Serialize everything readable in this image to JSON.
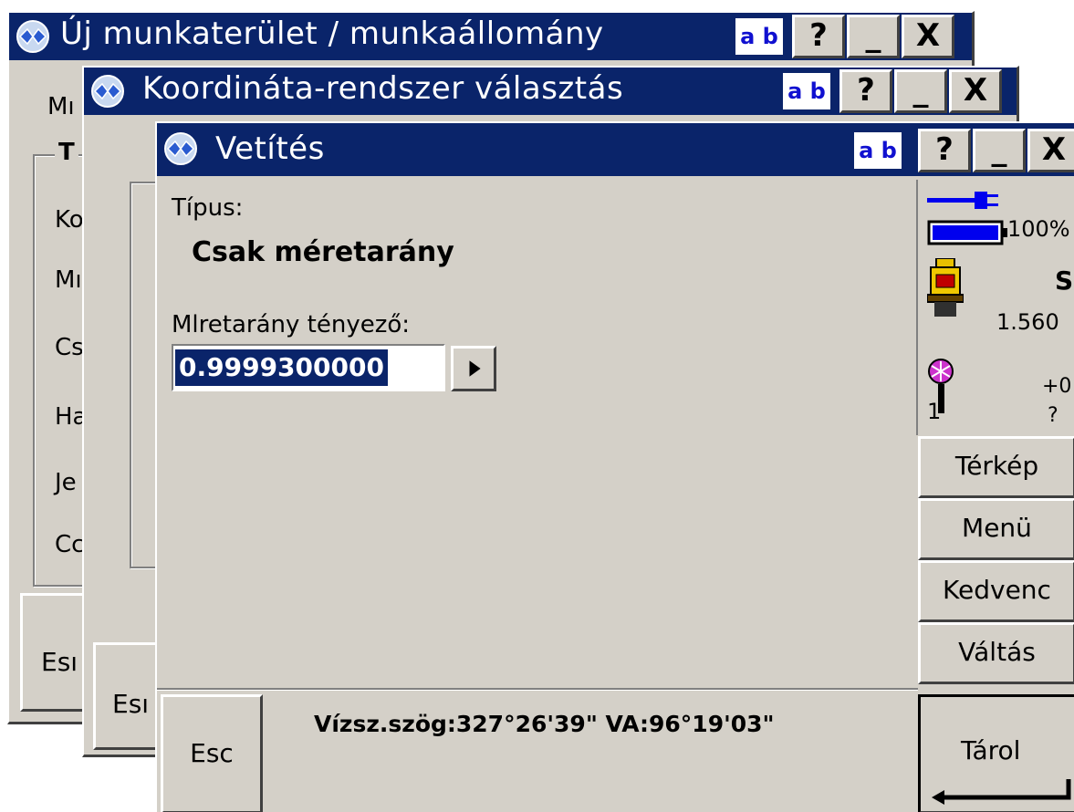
{
  "windows": {
    "back": {
      "title": "Új munkaterület / munkaállomány",
      "ab_label": "a b",
      "help_label": "?",
      "minimize_label": "_",
      "close_label": "X",
      "partial_labels": [
        "Mı",
        "Ko",
        "Mı",
        "Cs",
        "Ha",
        "Je",
        "Cc"
      ],
      "group_label": "T",
      "esc_label": "Esı"
    },
    "middle": {
      "title": "Koordináta-rendszer választás",
      "ab_label": "a b",
      "help_label": "?",
      "minimize_label": "_",
      "close_label": "X",
      "esc_label": "Esı"
    },
    "front": {
      "title": "Vetítés",
      "ab_label": "a b",
      "help_label": "?",
      "minimize_label": "_",
      "close_label": "X",
      "type_label": "Típus:",
      "type_value": "Csak méretarány",
      "scale_label": "Mlretarány tényező:",
      "scale_value": "0.9999300000",
      "esc_label": "Esc",
      "status_text": "Vízsz.szög:327°26'39\"  VA:96°19'03\"",
      "store_label": "Tárol"
    }
  },
  "status_panel": {
    "battery_percent": "100%",
    "battery_level": 1.0,
    "instrument_code": "S",
    "instrument_height": "1.560",
    "target_number": "1",
    "target_offset": "+0",
    "target_height": "?"
  },
  "side_buttons": [
    "Térkép",
    "Menü",
    "Kedvenc",
    "Váltás"
  ],
  "colors": {
    "titlebar": "#0a246a",
    "face": "#d4d0c8",
    "selection": "#0a246a",
    "ab_text": "#1010d0",
    "battery": "#0000ee",
    "target": "#cc33cc"
  }
}
